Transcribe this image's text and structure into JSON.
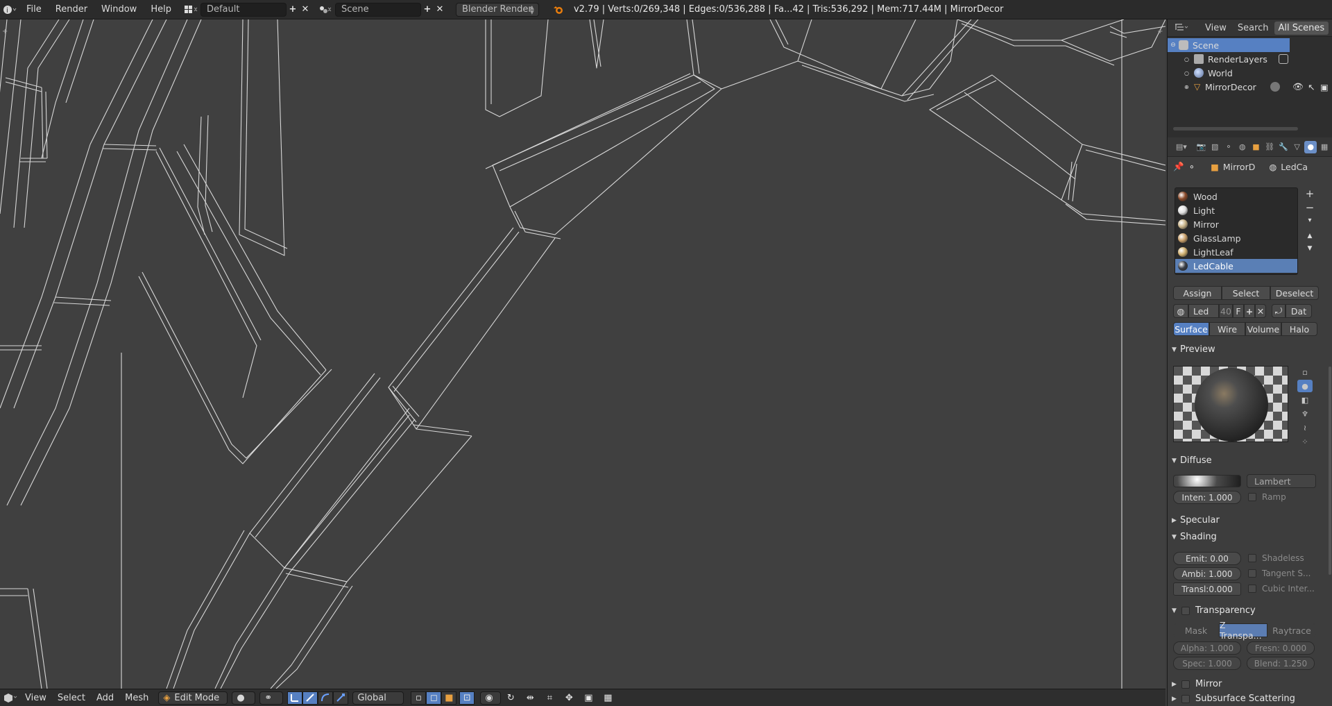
{
  "topbar": {
    "menus": [
      "File",
      "Render",
      "Window",
      "Help"
    ],
    "layout": "Default",
    "scene": "Scene",
    "engine": "Blender Render",
    "stats": "v2.79 | Verts:0/269,348 | Edges:0/536,288 | Fa...42 | Tris:536,292 | Mem:717.44M | MirrorDecor"
  },
  "bottombar": {
    "menus": [
      "View",
      "Select",
      "Add",
      "Mesh"
    ],
    "mode": "Edit Mode",
    "orientation": "Global"
  },
  "outliner": {
    "menus": [
      "View",
      "Search"
    ],
    "filter": "All Scenes",
    "items": [
      "Scene",
      "RenderLayers",
      "World",
      "MirrorDecor"
    ]
  },
  "properties": {
    "breadcrumb": [
      "MirrorD",
      "LedCa"
    ],
    "materials": [
      "Wood",
      "Light",
      "Mirror",
      "GlassLamp",
      "LightLeaf",
      "LedCable"
    ],
    "material_colors": [
      "#8a4a2a",
      "#e0e0e0",
      "#c9b48a",
      "#c9a06a",
      "#d0b070",
      "#3a3f48"
    ],
    "actions": [
      "Assign",
      "Select",
      "Deselect"
    ],
    "datablock": {
      "name": "Led",
      "users": "40",
      "fake": "F",
      "link": "Dat"
    },
    "tabs": [
      "Surface",
      "Wire",
      "Volume",
      "Halo"
    ],
    "panels": {
      "preview": "Preview",
      "diffuse": "Diffuse",
      "specular": "Specular",
      "shading": "Shading",
      "transparency": "Transparency",
      "mirror": "Mirror",
      "sss": "Subsurface Scattering"
    },
    "diffuse": {
      "shader": "Lambert",
      "intensity": "Inten: 1.000",
      "ramp": "Ramp",
      "color": "#4a4a4a"
    },
    "shading": {
      "emit": "Emit: 0.00",
      "ambient": "Ambi: 1.000",
      "translucency": "Transl:0.000",
      "shadeless": "Shadeless",
      "tangent": "Tangent S...",
      "cubic": "Cubic Inter..."
    },
    "transparency": {
      "modes": [
        "Mask",
        "Z Transpa...",
        "Raytrace"
      ],
      "alpha": "Alpha: 1.000",
      "fresnel": "Fresn: 0.000",
      "spec": "Spec: 1.000",
      "blend": "Blend: 1.250"
    }
  }
}
